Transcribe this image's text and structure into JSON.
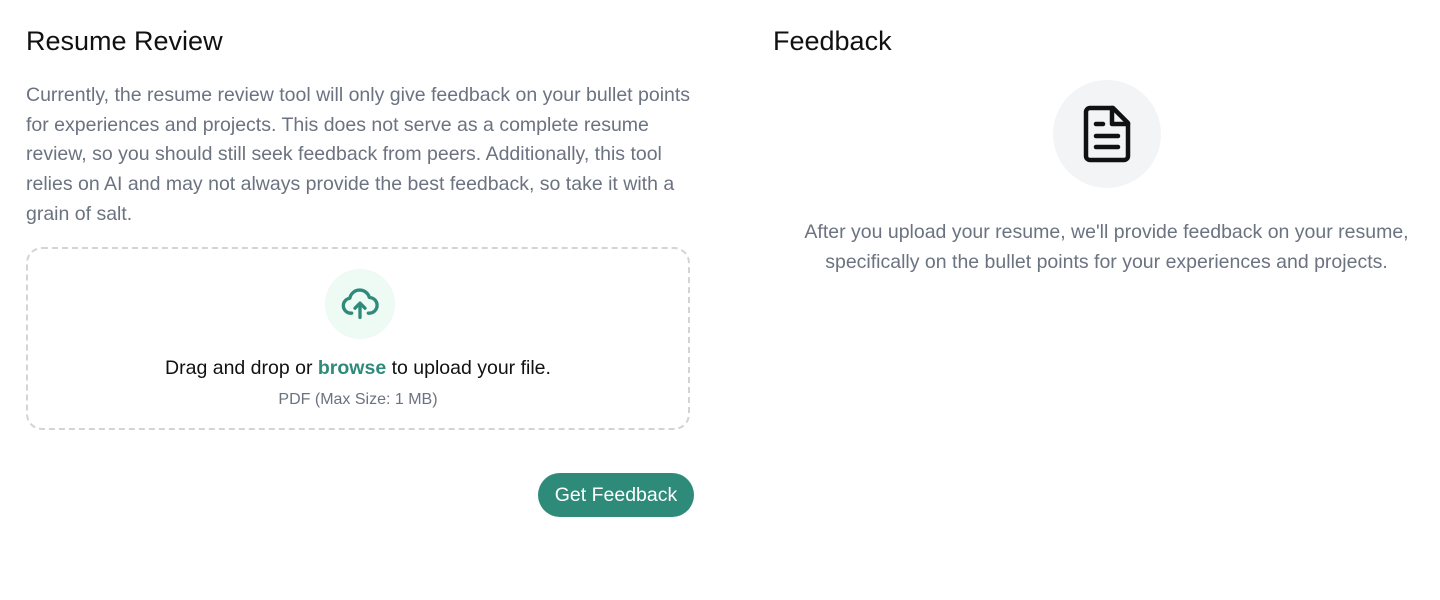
{
  "review": {
    "title": "Resume Review",
    "description": "Currently, the resume review tool will only give feedback on your bullet points for experiences and projects. This does not serve as a complete resume review, so you should still seek feedback from peers. Additionally, this tool relies on AI and may not always provide the best feedback, so take it with a grain of salt.",
    "upload": {
      "icon": "cloud-upload-icon",
      "prefix": "Drag and drop or ",
      "browse_label": "browse",
      "suffix": " to upload your file.",
      "hint": "PDF (Max Size: 1 MB)"
    },
    "submit_label": "Get Feedback"
  },
  "feedback": {
    "title": "Feedback",
    "icon": "document-icon",
    "empty_message": "After you upload your resume, we'll provide feedback on your resume, specifically on the bullet points for your experiences and projects."
  },
  "colors": {
    "accent": "#2e8b7a",
    "muted_text": "#6b7280",
    "heading_text": "#111111",
    "upload_icon_bg": "#eefaf4",
    "doc_icon_bg": "#f3f4f6",
    "dropzone_border": "#d4d4d8"
  }
}
